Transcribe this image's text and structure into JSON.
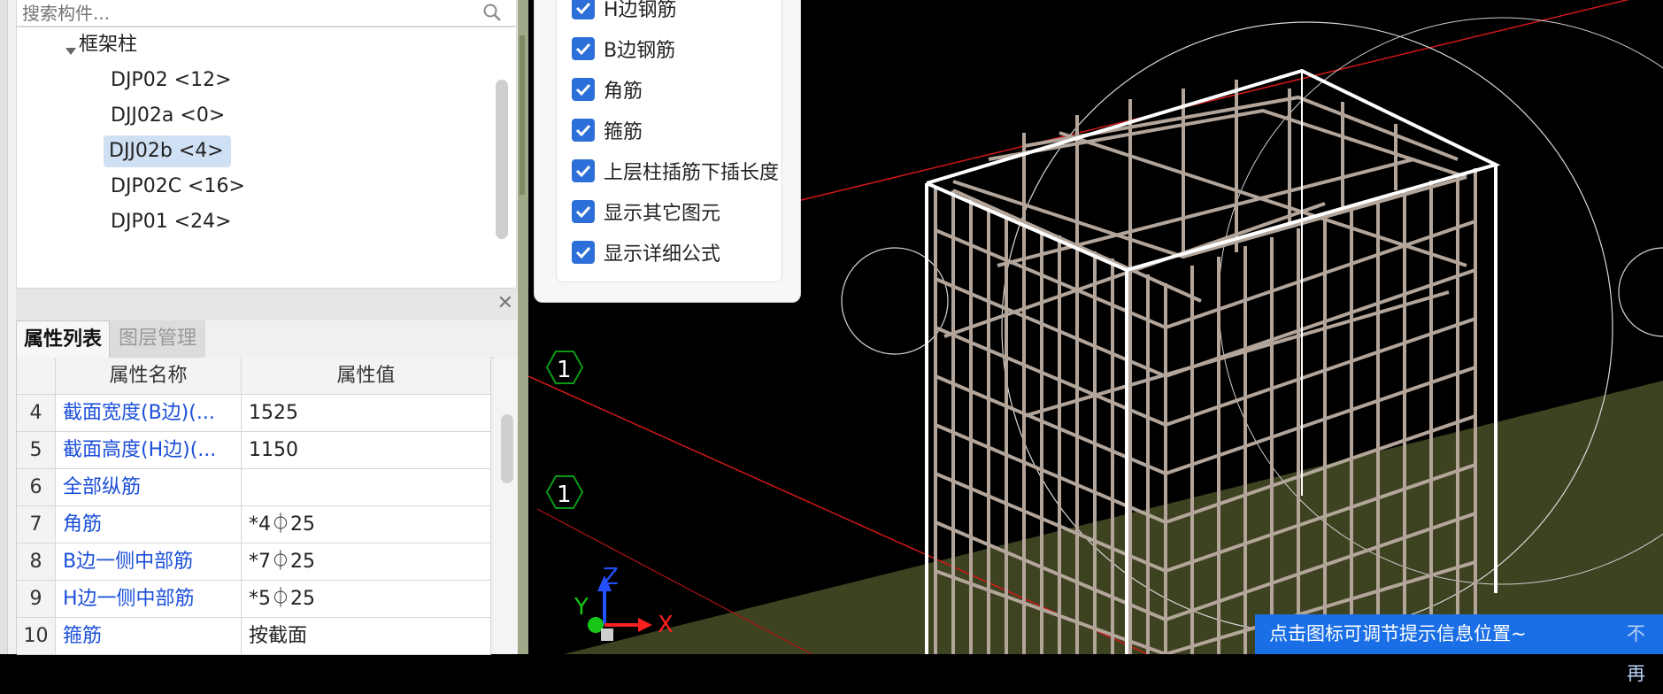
{
  "search": {
    "placeholder": "搜索构件..."
  },
  "tree": {
    "parent": "框架柱",
    "items": [
      {
        "label": "DJP02 <12>",
        "selected": false
      },
      {
        "label": "DJJ02a <0>",
        "selected": false
      },
      {
        "label": "DJJ02b <4>",
        "selected": true
      },
      {
        "label": "DJP02C <16>",
        "selected": false
      },
      {
        "label": "DJP01 <24>",
        "selected": false
      }
    ]
  },
  "props_panel": {
    "tabs": [
      {
        "label": "属性列表",
        "active": true
      },
      {
        "label": "图层管理",
        "active": false
      }
    ],
    "headers": {
      "name": "属性名称",
      "value": "属性值"
    },
    "rows": [
      {
        "num": "4",
        "name": "截面宽度(B边)(...",
        "value": "1525"
      },
      {
        "num": "5",
        "name": "截面高度(H边)(...",
        "value": "1150"
      },
      {
        "num": "6",
        "name": "全部纵筋",
        "value": ""
      },
      {
        "num": "7",
        "name": "角筋",
        "value": "*4⏀25"
      },
      {
        "num": "8",
        "name": "B边一侧中部筋",
        "value": "*7⏀25"
      },
      {
        "num": "9",
        "name": "H边一侧中部筋",
        "value": "*5⏀25"
      },
      {
        "num": "10",
        "name": "箍筋",
        "value": "按截面"
      }
    ]
  },
  "display_options": {
    "items": [
      {
        "label": "H边钢筋",
        "checked": true
      },
      {
        "label": "B边钢筋",
        "checked": true
      },
      {
        "label": "角筋",
        "checked": true
      },
      {
        "label": "箍筋",
        "checked": true
      },
      {
        "label": "上层柱插筋下插长度",
        "checked": true
      },
      {
        "label": "显示其它图元",
        "checked": true
      },
      {
        "label": "显示详细公式",
        "checked": true
      }
    ]
  },
  "viewport": {
    "axis_markers": [
      "1",
      "1"
    ],
    "axes": {
      "x": "X",
      "y": "Y",
      "z": "Z"
    },
    "hint": "点击图标可调节提示信息位置~",
    "hint_close": "不再",
    "colors": {
      "background": "#000000",
      "ground": "#3d4220",
      "rebar": "#b3a59a",
      "frame": "#ffffff",
      "axis_marker": "#0b9a18",
      "grid_line": "#d21818",
      "hint_bg": "#1b6fe6"
    }
  }
}
